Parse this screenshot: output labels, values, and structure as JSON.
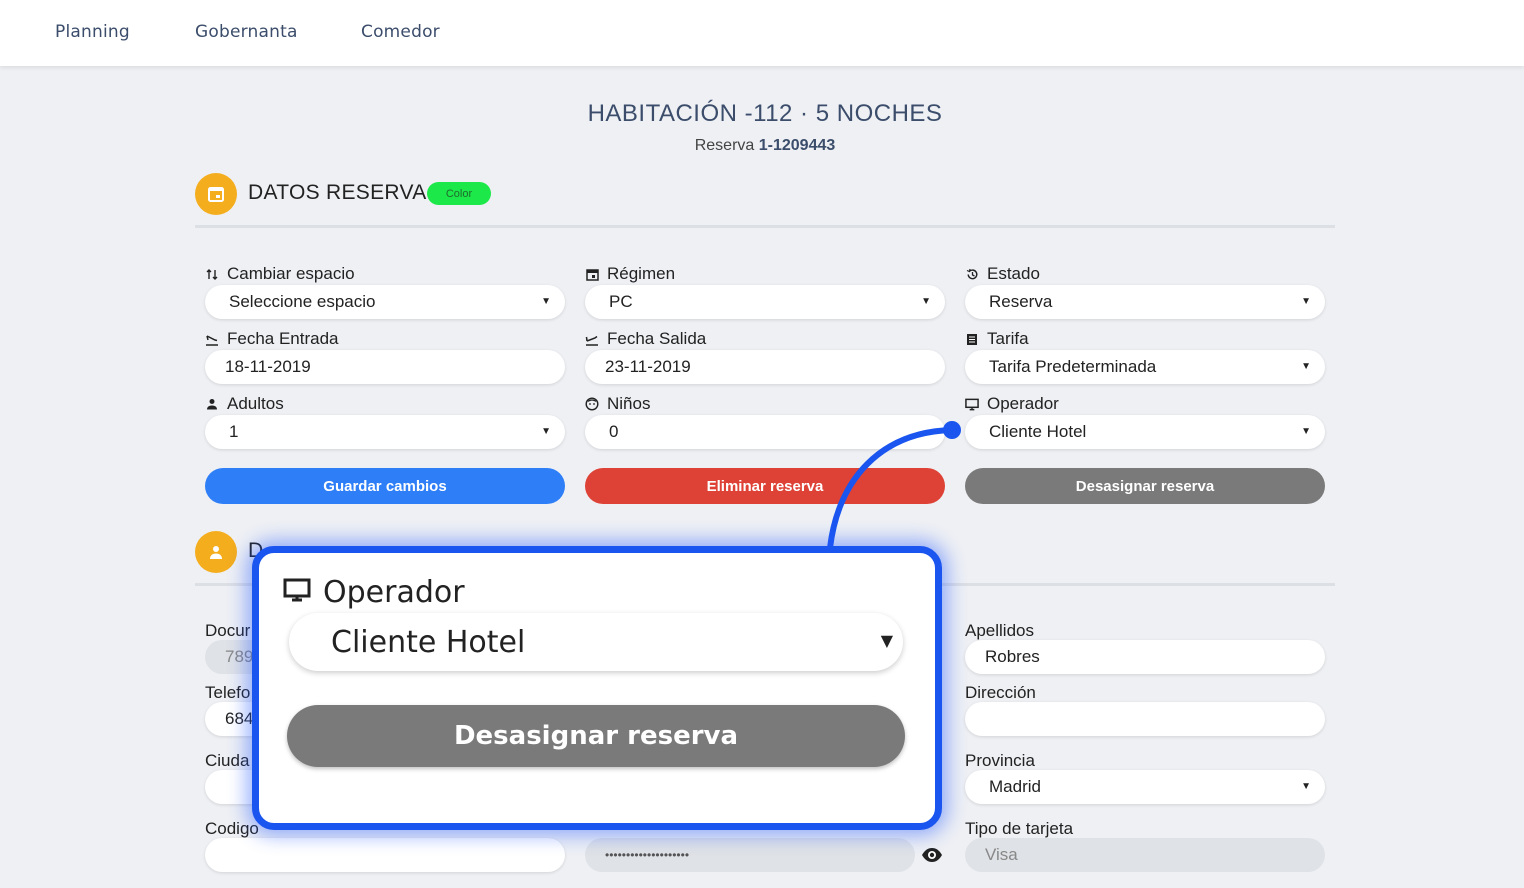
{
  "nav": {
    "planning": "Planning",
    "gobernanta": "Gobernanta",
    "comedor": "Comedor"
  },
  "header": {
    "title": "HABITACIÓN -112 · 5 NOCHES",
    "subtitle_prefix": "Reserva ",
    "subtitle_id": "1-1209443"
  },
  "reserva": {
    "section_title": "DATOS RESERVA",
    "badge": "Color",
    "cambiar_espacio": {
      "label": "Cambiar espacio",
      "value": "Seleccione espacio"
    },
    "regimen": {
      "label": "Régimen",
      "value": "PC"
    },
    "estado": {
      "label": "Estado",
      "value": "Reserva"
    },
    "fecha_entrada": {
      "label": "Fecha Entrada",
      "value": "18-11-2019"
    },
    "fecha_salida": {
      "label": "Fecha Salida",
      "value": "23-11-2019"
    },
    "tarifa": {
      "label": "Tarifa",
      "value": "Tarifa Predeterminada"
    },
    "adultos": {
      "label": "Adultos",
      "value": "1"
    },
    "ninos": {
      "label": "Niños",
      "value": "0"
    },
    "operador": {
      "label": "Operador",
      "value": "Cliente Hotel"
    },
    "guardar": "Guardar cambios",
    "eliminar": "Eliminar reserva",
    "desasignar": "Desasignar reserva"
  },
  "cliente": {
    "section_title_partial": "D",
    "documento_label": "Docur",
    "documento_value": "789",
    "telefono_label": "Telefo",
    "telefono_value": "684",
    "ciudad_label": "Ciuda",
    "codigo_label": "Codigo",
    "apellidos": {
      "label": "Apellidos",
      "value": "Robres"
    },
    "direccion": {
      "label": "Dirección",
      "value": ""
    },
    "provincia": {
      "label": "Provincia",
      "value": "Madrid"
    },
    "tipo_tarjeta": {
      "label": "Tipo de tarjeta",
      "value": "Visa"
    },
    "numero_tarjeta_value": "••••••••••••••••••••"
  },
  "zoom": {
    "label": "Operador",
    "value": "Cliente Hotel",
    "button": "Desasignar reserva"
  },
  "colors": {
    "accent_orange": "#f4ad1d",
    "blue": "#2d7ef7",
    "red": "#de4236",
    "gray": "#7a7a7a",
    "badge_green": "#1de84a",
    "highlight": "#1a55f0"
  }
}
